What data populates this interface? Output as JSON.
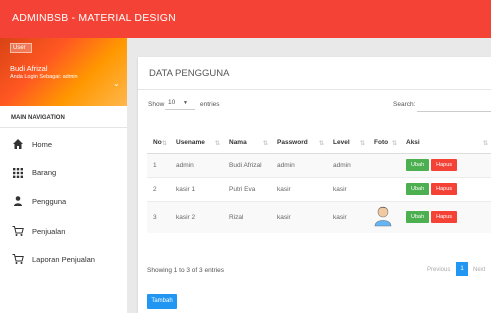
{
  "app": {
    "brand": "ADMINBSB - MATERIAL DESIGN"
  },
  "user": {
    "image_text": "User",
    "name": "Budi Afrizal",
    "role": "Anda Login Sebagai: admin",
    "caret": "⌄"
  },
  "nav": {
    "header": "MAIN NAVIGATION",
    "items": [
      {
        "label": "Home",
        "icon": "home-icon"
      },
      {
        "label": "Barang",
        "icon": "grid-icon"
      },
      {
        "label": "Pengguna",
        "icon": "person-icon"
      },
      {
        "label": "Penjualan",
        "icon": "cart-icon"
      },
      {
        "label": "Laporan Penjualan",
        "icon": "cart-icon"
      }
    ]
  },
  "card": {
    "title": "DATA PENGGUNA"
  },
  "controls": {
    "show": "Show",
    "length_value": "10",
    "entries": "entries",
    "search_label": "Search:"
  },
  "table": {
    "columns": [
      "No",
      "Usename",
      "Nama",
      "Password",
      "Level",
      "Foto",
      "Aksi"
    ],
    "rows": [
      {
        "no": "1",
        "username": "admin",
        "nama": "Budi Afrizal",
        "password": "admin",
        "level": "admin",
        "foto": ""
      },
      {
        "no": "2",
        "username": "kasir 1",
        "nama": "Putri Eva",
        "password": "kasir",
        "level": "kasir",
        "foto": ""
      },
      {
        "no": "3",
        "username": "kasir 2",
        "nama": "Rizal",
        "password": "kasir",
        "level": "kasir",
        "foto": "avatar-icon"
      }
    ],
    "edit_label": "Ubah",
    "delete_label": "Hapus"
  },
  "footer": {
    "info": "Showing 1 to 3 of 3 entries",
    "previous": "Previous",
    "page": "1",
    "next": "Next"
  },
  "actions": {
    "add_label": "Tambah"
  },
  "colors": {
    "topbar": "#f44336",
    "green": "#4caf50",
    "red": "#f44336",
    "blue": "#2196f3"
  }
}
